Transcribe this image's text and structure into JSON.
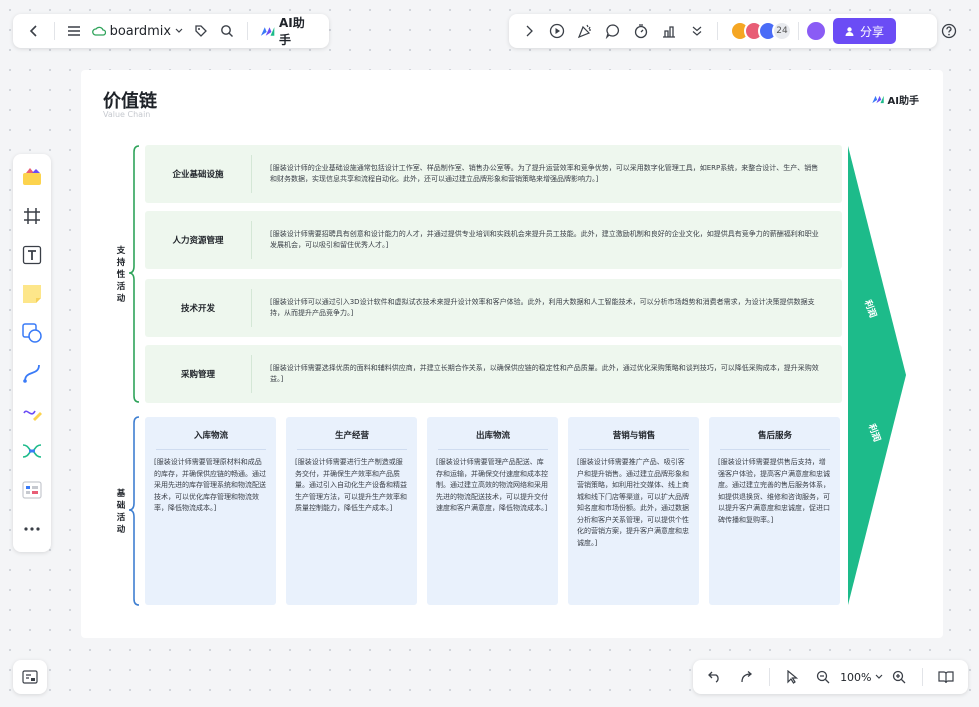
{
  "topbar": {
    "brand_name": "boardmix",
    "ai_label": "AI助手",
    "avatar_count": "24",
    "share_label": "分享"
  },
  "bottombar": {
    "zoom": "100%"
  },
  "board": {
    "title": "价值链",
    "subtitle": "Value Chain",
    "ai_label": "AI助手",
    "support_label": "支持性活动",
    "primary_label": "基础活动",
    "margin_label_top": "利润",
    "margin_label_bottom": "利润",
    "support_rows": [
      {
        "title": "企业基础设施",
        "text": "[服装设计师的企业基础设施通常包括设计工作室、样品制作室、销售办公室等。为了提升运营效率和竞争优势，可以采用数字化管理工具，如ERP系统，来整合设计、生产、销售和财务数据，实现信息共享和流程自动化。此外，还可以通过建立品牌形象和营销策略来增强品牌影响力。]"
      },
      {
        "title": "人力资源管理",
        "text": "[服装设计师需要招聘具有创意和设计能力的人才，并通过提供专业培训和实践机会来提升员工技能。此外，建立激励机制和良好的企业文化，如提供具有竞争力的薪酬福利和职业发展机会，可以吸引和留住优秀人才。]"
      },
      {
        "title": "技术开发",
        "text": "[服装设计师可以通过引入3D设计软件和虚拟试衣技术来提升设计效率和客户体验。此外，利用大数据和人工智能技术，可以分析市场趋势和消费者需求，为设计决策提供数据支持，从而提升产品竞争力。]"
      },
      {
        "title": "采购管理",
        "text": "[服装设计师需要选择优质的面料和辅料供应商，并建立长期合作关系，以确保供应链的稳定性和产品质量。此外，通过优化采购策略和谈判技巧，可以降低采购成本，提升采购效益。]"
      }
    ],
    "primary_cols": [
      {
        "title": "入库物流",
        "text": "[服装设计师需要管理原材料和成品的库存，并确保供应链的畅通。通过采用先进的库存管理系统和物流配送技术，可以优化库存管理和物流效率，降低物流成本。]"
      },
      {
        "title": "生产经营",
        "text": "[服装设计师需要进行生产制造或服务交付，并确保生产效率和产品质量。通过引入自动化生产设备和精益生产管理方法，可以提升生产效率和质量控制能力，降低生产成本。]"
      },
      {
        "title": "出库物流",
        "text": "[服装设计师需要管理产品配送、库存和运输，并确保交付速度和成本控制。通过建立高效的物流网络和采用先进的物流配送技术，可以提升交付速度和客户满意度，降低物流成本。]"
      },
      {
        "title": "营销与销售",
        "text": "[服装设计师需要推广产品、吸引客户和提升销售。通过建立品牌形象和营销策略，如利用社交媒体、线上商城和线下门店等渠道，可以扩大品牌知名度和市场份额。此外，通过数据分析和客户关系管理，可以提供个性化的营销方案，提升客户满意度和忠诚度。]"
      },
      {
        "title": "售后服务",
        "text": "[服装设计师需要提供售后支持，增强客户体验，提高客户满意度和忠诚度。通过建立完善的售后服务体系，如提供退换货、维修和咨询服务，可以提升客户满意度和忠诚度，促进口碑传播和复购率。]"
      }
    ]
  },
  "colors": {
    "accent": "#6b4cf5",
    "support_bg": "#eef7ee",
    "support_bracket": "#2fa35a",
    "primary_bg": "#e9f1fc",
    "primary_bracket": "#3f7fd1",
    "arrow": "#1dbb8a"
  }
}
